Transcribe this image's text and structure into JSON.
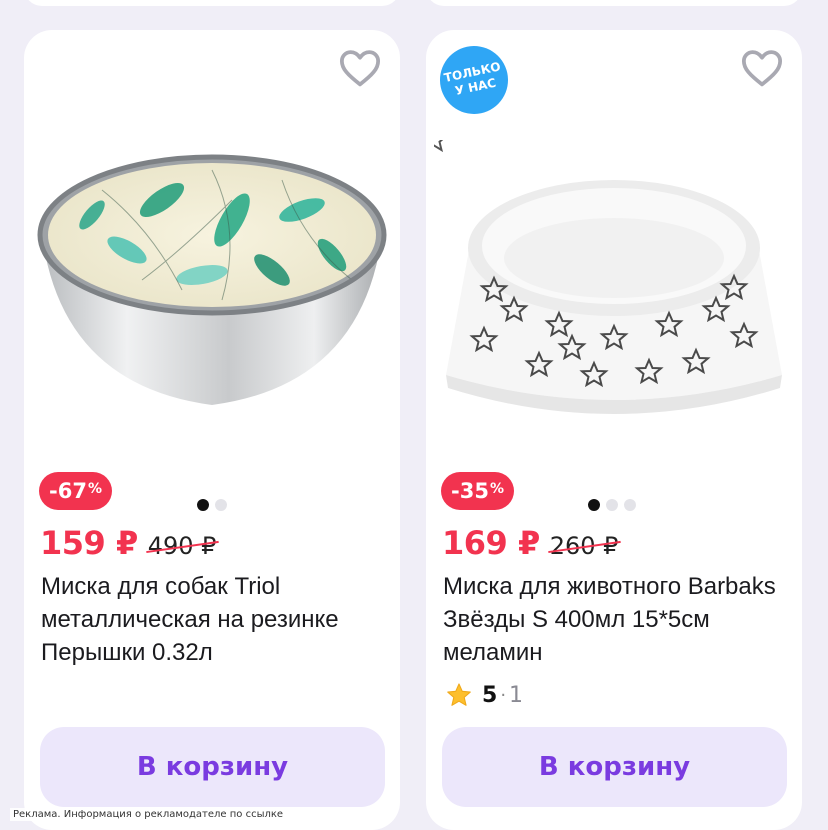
{
  "products": [
    {
      "discount": "-67",
      "discount_suffix": "%",
      "price": "159 ₽",
      "old_price": "490 ₽",
      "title": "Миска для собак Triol металлическая на резинке Перышки 0.32л",
      "cart_label": "В корзину",
      "image_count": 2
    },
    {
      "badge_line1": "ТОЛЬКО",
      "badge_line2": "У НАС",
      "discount": "-35",
      "discount_suffix": "%",
      "price": "169 ₽",
      "old_price": "260 ₽",
      "title": "Миска для животного Barbaks Звёзды S 400мл 15*5см меламин",
      "rating_score": "5",
      "rating_separator": "·",
      "rating_count": "1",
      "cart_label": "В корзину",
      "image_count": 3
    }
  ],
  "ad_note": "Реклама. Информация о рекламодателе по ссылке",
  "colors": {
    "accent": "#f2334f",
    "button_bg": "#ece7fb",
    "button_text": "#7a3be0",
    "badge": "#2fa6f5"
  }
}
